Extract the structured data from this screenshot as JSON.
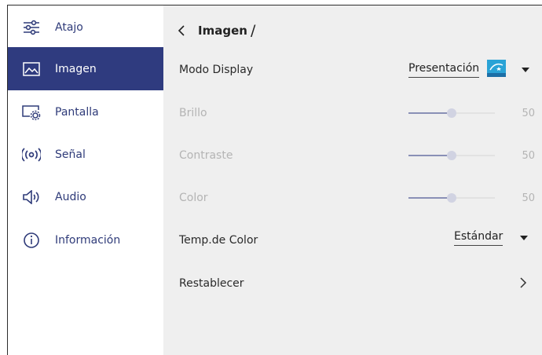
{
  "sidebar": {
    "items": [
      {
        "label": "Atajo",
        "icon": "sliders-icon",
        "active": false
      },
      {
        "label": "Imagen",
        "icon": "image-icon",
        "active": true
      },
      {
        "label": "Pantalla",
        "icon": "display-settings-icon",
        "active": false
      },
      {
        "label": "Señal",
        "icon": "signal-icon",
        "active": false
      },
      {
        "label": "Audio",
        "icon": "speaker-icon",
        "active": false
      },
      {
        "label": "Información",
        "icon": "info-icon",
        "active": false
      }
    ]
  },
  "main": {
    "breadcrumb": {
      "title": "Imagen",
      "separator": "/"
    },
    "display_mode": {
      "label": "Modo Display",
      "value": "Presentación",
      "badge_icon": "energy-star-icon"
    },
    "brightness": {
      "label": "Brillo",
      "value": "50",
      "level": 0.5
    },
    "contrast": {
      "label": "Contraste",
      "value": "50",
      "level": 0.5
    },
    "color": {
      "label": "Color",
      "value": "50",
      "level": 0.5
    },
    "color_temp": {
      "label": "Temp.de Color",
      "value": "Estándar"
    },
    "reset": {
      "label": "Restablecer"
    }
  },
  "colors": {
    "accent": "#2f3b7f",
    "panel_bg": "#efefef",
    "dim_text": "#b4b4b4"
  }
}
